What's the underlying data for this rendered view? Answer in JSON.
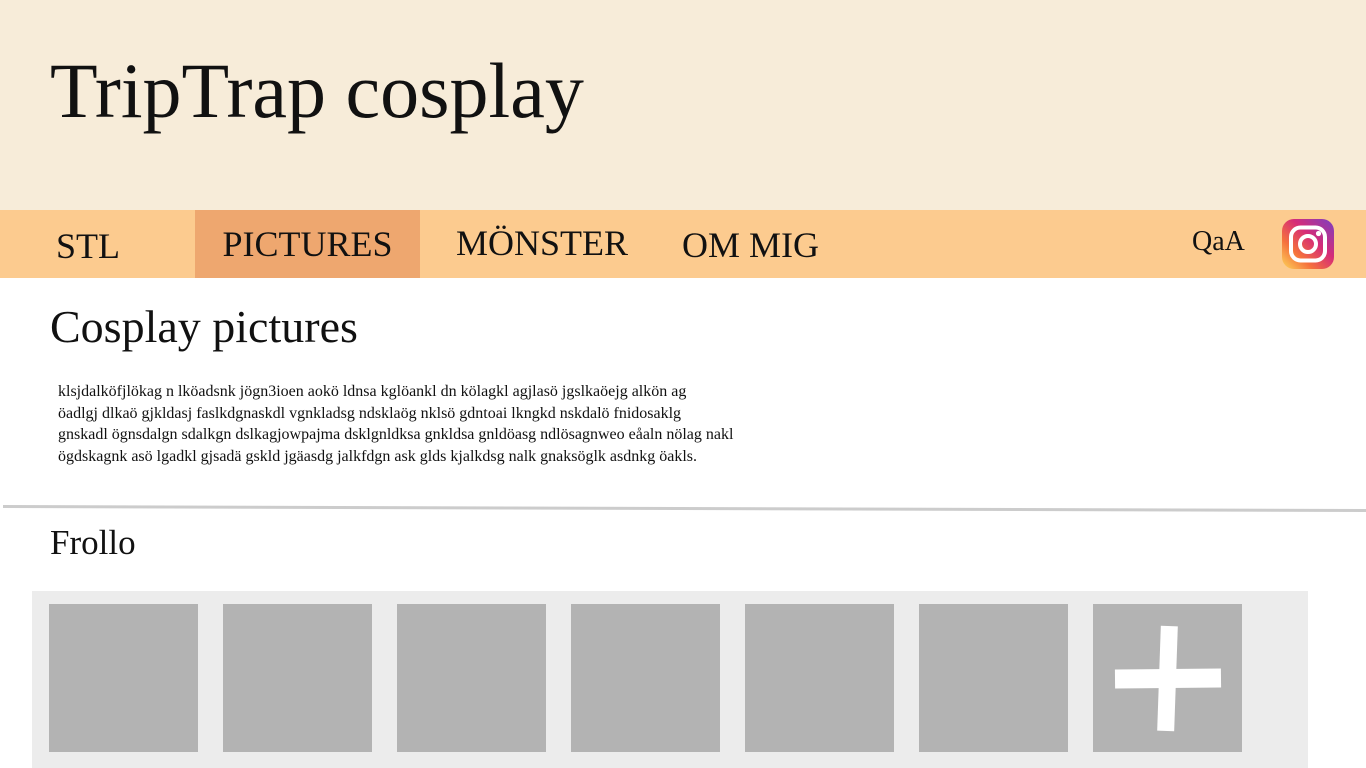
{
  "header": {
    "site_title": "TripTrap cosplay"
  },
  "nav": {
    "items": [
      {
        "label": "STL"
      },
      {
        "label": "PICTURES",
        "active": true
      },
      {
        "label": "MÖNSTER"
      },
      {
        "label": "OM MIG"
      }
    ],
    "qaa_label": "QaA",
    "social_icon": "instagram-icon"
  },
  "main": {
    "heading": "Cosplay pictures",
    "intro_lines": [
      "klsjdalköfjlökag n lköadsnk jögn3ioen aokö ldnsa kglöankl dn  kölagkl agjlasö jgslkaöejg alkön ag",
      "öadlgj dlkaö gjkldasj faslkdgnaskdl vgnkladsg ndsklaög nklsö gdntoai lkngkd nskdalö fnidosaklg",
      "gnskadl ögnsdalgn sdalkgn dslkagjowpajma dsklgnldksa gnkldsa gnldöasg ndlösagnweo eåaln nölag nakl",
      "ögdskagnk asö lgadkl gjsadä gskld jgäasdg jalkfdgn ask glds kjalkdsg nalk gnaksöglk asdnkg öakls."
    ]
  },
  "gallery": {
    "title": "Frollo",
    "thumbnail_count": 6,
    "add_icon": "plus-icon"
  },
  "colors": {
    "header_bg": "#f7ecd9",
    "nav_bg": "#fccb8f",
    "nav_active_bg": "#eea76f",
    "gallery_bg": "#ececec",
    "thumb_bg": "#b3b3b3"
  }
}
